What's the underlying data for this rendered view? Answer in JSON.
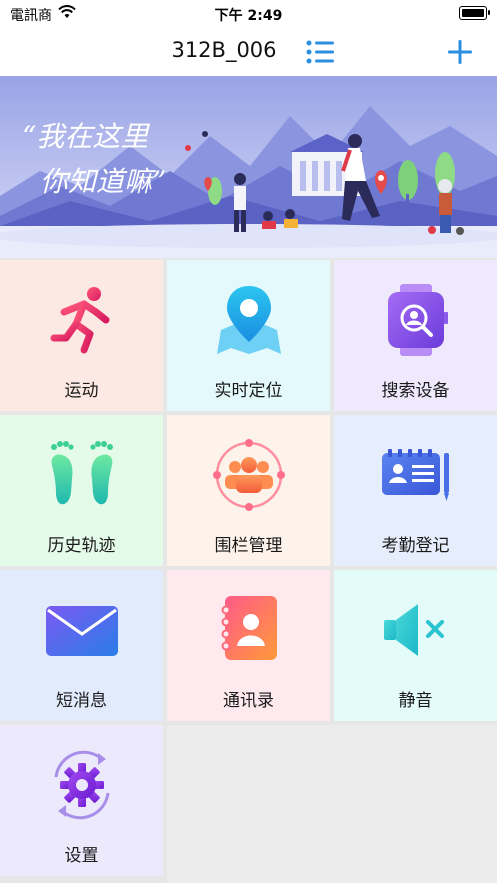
{
  "status_bar": {
    "carrier": "電訊商",
    "time": "下午 2:49"
  },
  "nav": {
    "title": "312B_006",
    "list_icon": "list-icon",
    "add_icon": "plus-icon"
  },
  "banner": {
    "slogan_line1": "“我在这里",
    "slogan_line2": "你知道嘛”"
  },
  "menu": {
    "items": [
      {
        "label": "运动",
        "icon": "running-icon",
        "bg": "#fde9e3"
      },
      {
        "label": "实时定位",
        "icon": "location-map-icon",
        "bg": "#e4f9fb"
      },
      {
        "label": "搜索设备",
        "icon": "watch-search-icon",
        "bg": "#efe9fd"
      },
      {
        "label": "历史轨迹",
        "icon": "footprints-icon",
        "bg": "#e4fbe9"
      },
      {
        "label": "围栏管理",
        "icon": "fence-group-icon",
        "bg": "#fdf3ea"
      },
      {
        "label": "考勤登记",
        "icon": "id-card-icon",
        "bg": "#e6edfc"
      },
      {
        "label": "短消息",
        "icon": "envelope-icon",
        "bg": "#e2ebfb"
      },
      {
        "label": "通讯录",
        "icon": "contacts-icon",
        "bg": "#fde9ee"
      },
      {
        "label": "静音",
        "icon": "mute-speaker-icon",
        "bg": "#e3fbf9"
      },
      {
        "label": "设置",
        "icon": "settings-gear-icon",
        "bg": "#ece9fc"
      }
    ]
  }
}
